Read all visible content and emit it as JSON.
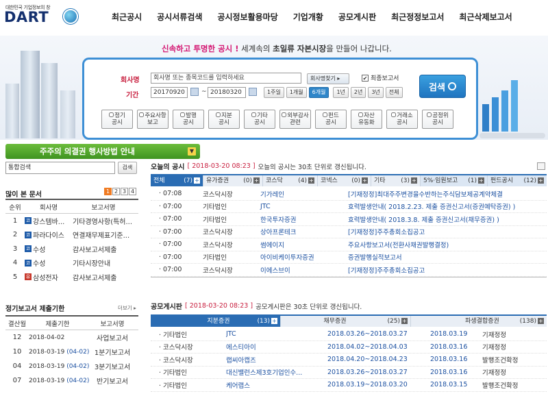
{
  "header": {
    "logo_sub": "대한민국 기업정보의 창",
    "logo": "DART",
    "nav": [
      "최근공시",
      "공시서류검색",
      "공시정보활용마당",
      "기업개황",
      "공모게시판",
      "최근정정보고서",
      "최근삭제보고서"
    ]
  },
  "hero": {
    "slogan_pink": "신속하고 투명한 공시 !",
    "slogan_mid": " 세계속의 ",
    "slogan_bold": "초일류 자본시장",
    "slogan_end": "을 만들어 나갑니다."
  },
  "search": {
    "company_label": "회사명",
    "company_placeholder": "회사명 또는 종목코드를 입력하세요",
    "company_find_btn": "회사명찾기 ▸",
    "final_report_label": "최종보고서",
    "period_label": "기간",
    "date_from": "20170920",
    "date_sep": "~",
    "date_to": "20180320",
    "periods": [
      "1주일",
      "1개월",
      "6개월",
      "1년",
      "2년",
      "3년",
      "전체"
    ],
    "selected_period": "6개월",
    "search_btn": "검색",
    "categories": [
      [
        "정기",
        "공시"
      ],
      [
        "주요사항",
        "보고"
      ],
      [
        "발행",
        "공시"
      ],
      [
        "지분",
        "공시"
      ],
      [
        "기타",
        "공시"
      ],
      [
        "외부감사",
        "관련"
      ],
      [
        "펀드",
        "공시"
      ],
      [
        "자산",
        "유동화"
      ],
      [
        "거래소",
        "공시"
      ],
      [
        "공정위",
        "공시"
      ]
    ]
  },
  "green_bar": "주주의 의결권 행사방법 안내",
  "integrated_search": {
    "placeholder": "통합검색",
    "button": "검색"
  },
  "popular": {
    "title": "많이 본 문서",
    "pages": [
      "1",
      "2",
      "3",
      "4"
    ],
    "headers": [
      "순위",
      "회사명",
      "보고서명"
    ],
    "rows": [
      {
        "rank": "1",
        "mkt": "코",
        "company": "강스템바...",
        "report": "기타경영사항(특허..."
      },
      {
        "rank": "2",
        "mkt": "코",
        "company": "파라다이스",
        "report": "연결재무제표기준..."
      },
      {
        "rank": "3",
        "mkt": "코",
        "company": "수성",
        "report": "감사보고서제출"
      },
      {
        "rank": "4",
        "mkt": "코",
        "company": "수성",
        "report": "기타시장안내"
      },
      {
        "rank": "5",
        "mkt": "유",
        "company": "삼성전자",
        "report": "감사보고서제출"
      }
    ]
  },
  "deadline": {
    "title": "정기보고서 제출기한",
    "more": "더보기 ▸",
    "headers": [
      "결산월",
      "제출기한",
      "보고서명"
    ],
    "rows": [
      {
        "month": "12",
        "date": "2018-04-02",
        "extra": "",
        "report": "사업보고서"
      },
      {
        "month": "10",
        "date": "2018-03-19",
        "extra": "(04-02)",
        "report": "1분기보고서"
      },
      {
        "month": "04",
        "date": "2018-03-19",
        "extra": "(04-02)",
        "report": "3분기보고서"
      },
      {
        "month": "07",
        "date": "2018-03-19",
        "extra": "(04-02)",
        "report": "반기보고서"
      }
    ]
  },
  "today": {
    "title": "오늘의 공시",
    "timestamp": "[ 2018-03-20 08:23 ]",
    "note": "오늘의 공시는 30초 단위로 갱신됩니다.",
    "tabs": [
      {
        "label": "전체",
        "count": "(7)"
      },
      {
        "label": "유가증권",
        "count": "(0)"
      },
      {
        "label": "코스닥",
        "count": "(4)"
      },
      {
        "label": "코넥스",
        "count": "(0)"
      },
      {
        "label": "기타",
        "count": "(3)"
      },
      {
        "label": "5%·임원보고",
        "count": "(1)"
      },
      {
        "label": "펀드공시",
        "count": "(12)"
      }
    ],
    "rows": [
      {
        "time": "07:08",
        "market": "코스닥시장",
        "company": "기가레인",
        "report": "[기재정정]최대주주변경을수반하는주식담보제공계약체결"
      },
      {
        "time": "07:00",
        "market": "기타법인",
        "company": "JTC",
        "report": "효력발생안내( 2018.2.23. 제출 증권신고서(증권예탁증권) )"
      },
      {
        "time": "07:00",
        "market": "기타법인",
        "company": "한국투자증권",
        "report": "효력발생안내( 2018.3.8. 제출 증권신고서(채무증권) )"
      },
      {
        "time": "07:00",
        "market": "코스닥시장",
        "company": "상아프론테크",
        "report": "[기재정정]주주총회소집공고"
      },
      {
        "time": "07:00",
        "market": "코스닥시장",
        "company": "썸에이지",
        "report": "주요사항보고서(전환사채권발행결정)"
      },
      {
        "time": "07:00",
        "market": "기타법인",
        "company": "아이비케이투자증권",
        "report": "증권발행실적보고서"
      },
      {
        "time": "07:00",
        "market": "코스닥시장",
        "company": "이에스브이",
        "report": "[기재정정]주주총회소집공고"
      }
    ]
  },
  "offering": {
    "title": "공모게시판",
    "timestamp": "[ 2018-03-20 08:23 ]",
    "note": "공모게시판은 30초 단위로 갱신됩니다.",
    "tabs": [
      {
        "label": "지분증권",
        "count": "(13)"
      },
      {
        "label": "채무증권",
        "count": "(25)"
      },
      {
        "label": "파생결합증권",
        "count": "(138)"
      }
    ],
    "rows": [
      {
        "market": "기타법인",
        "company": "JTC",
        "period": "2018.03.26~2018.03.27",
        "date": "2018.03.19",
        "status": "기재정정"
      },
      {
        "market": "코스닥시장",
        "company": "에스티아이",
        "period": "2018.04.02~2018.04.03",
        "date": "2018.03.16",
        "status": "기재정정"
      },
      {
        "market": "코스닥시장",
        "company": "랩씨아캡즈",
        "period": "2018.04.20~2018.04.23",
        "date": "2018.03.16",
        "status": "발행조건확정"
      },
      {
        "market": "기타법인",
        "company": "대신밸런스제3호기업인수...",
        "period": "2018.03.26~2018.03.27",
        "date": "2018.03.16",
        "status": "기재정정"
      },
      {
        "market": "기타법인",
        "company": "케어랩스",
        "period": "2018.03.19~2018.03.20",
        "date": "2018.03.15",
        "status": "발행조건확정"
      }
    ]
  },
  "colors": {
    "brand": "#14306e",
    "accent": "#2f86c9",
    "green": "#4ba428",
    "pink": "#d41873",
    "red": "#c81e3e"
  }
}
